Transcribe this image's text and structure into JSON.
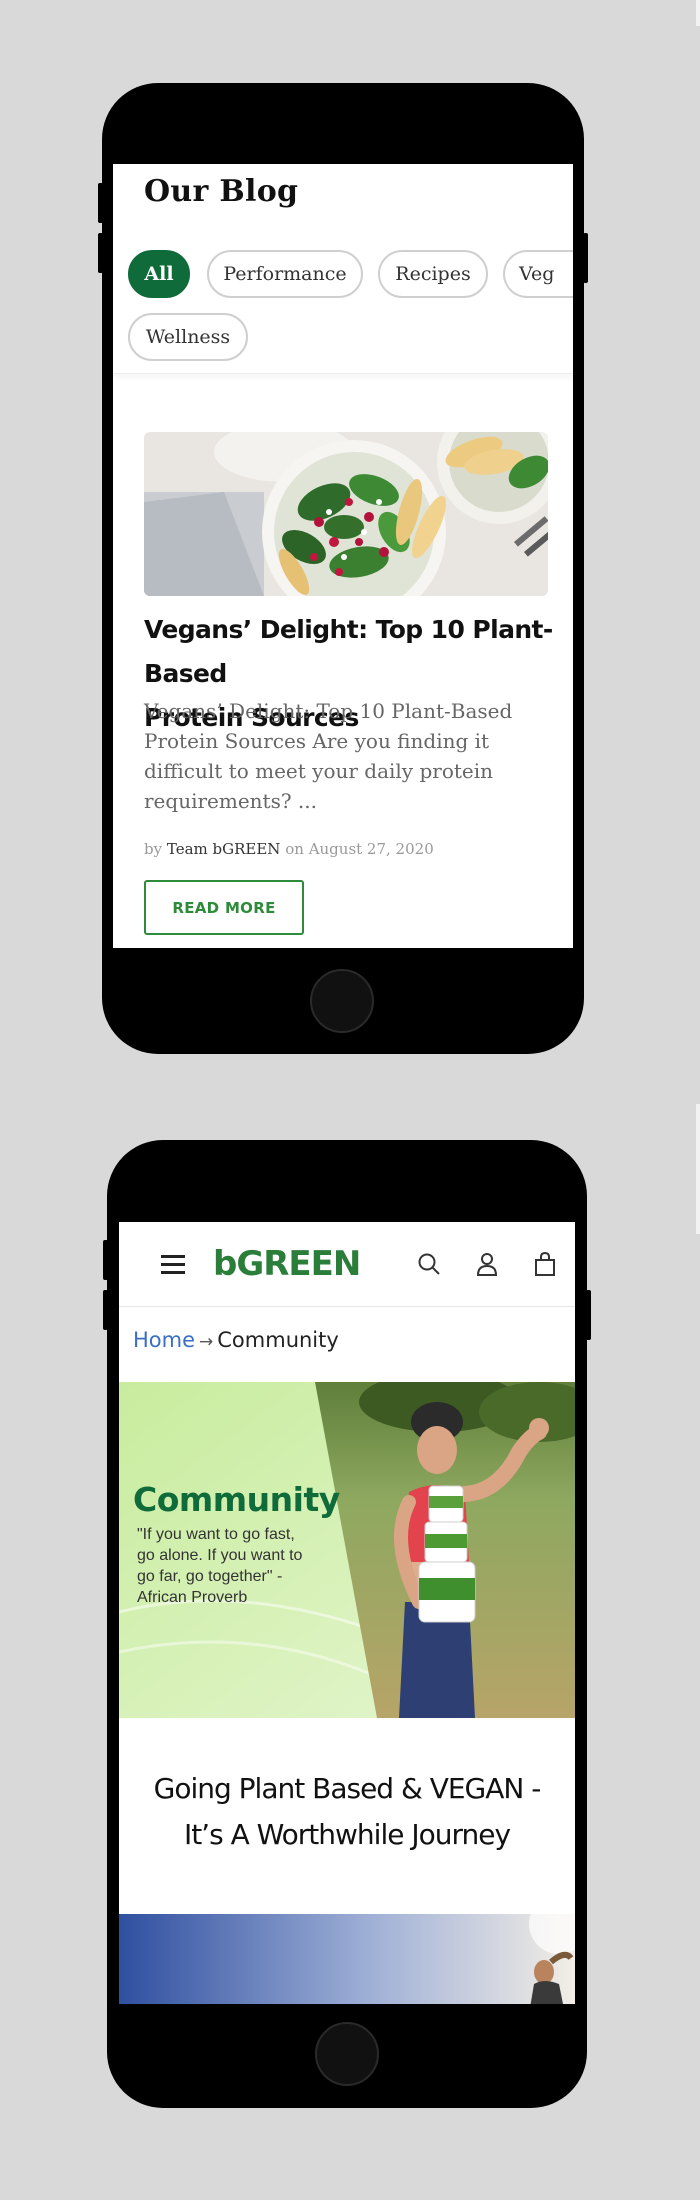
{
  "blog": {
    "title": "Our Blog",
    "filters": [
      {
        "label": "All",
        "active": true
      },
      {
        "label": "Performance",
        "active": false
      },
      {
        "label": "Recipes",
        "active": false
      },
      {
        "label": "Veg",
        "active": false
      },
      {
        "label": "Wellness",
        "active": false
      }
    ],
    "post": {
      "title_line1": "Vegans’ Delight: Top 10 Plant-Based",
      "title_line2": "Protein Sources",
      "excerpt": "Vegans’ Delight: Top 10 Plant-Based Protein Sources Are you finding it difficult to meet your daily protein requirements? ...",
      "meta_by": "by",
      "author": "Team bGREEN",
      "meta_on": "on",
      "date": "August 27, 2020",
      "read_more": "READ MORE"
    }
  },
  "community": {
    "logo": "bGREEN",
    "icons": [
      "menu-icon",
      "search-icon",
      "account-icon",
      "cart-icon"
    ],
    "breadcrumb": {
      "home": "Home",
      "separator": "→",
      "current": "Community"
    },
    "hero": {
      "title": "Community",
      "quote_line1": "\"If you want to go fast,",
      "quote_line2": "go alone. If you want to",
      "quote_line3": "go far, go together\" -",
      "quote_line4": "African Proverb"
    },
    "headline_line1": "Going Plant Based & VEGAN -",
    "headline_line2": "It’s A Worthwhile Journey"
  },
  "colors": {
    "brand_green": "#0f6b3a",
    "logo_green": "#2b7d3a",
    "button_green": "#2e8b3a",
    "link_blue": "#3a6fc4",
    "background": "#d9d9d9"
  }
}
